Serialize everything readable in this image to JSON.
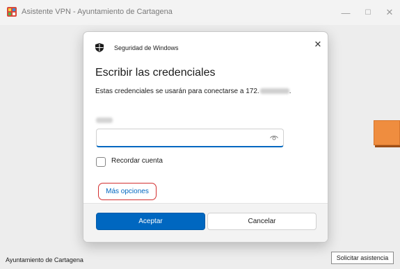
{
  "window": {
    "title": "Asistente VPN - Ayuntamiento de Cartagena",
    "footer_label": "Ayuntamiento de Cartagena",
    "assist_button": "Solicitar asistencia",
    "minimize_glyph": "—",
    "maximize_glyph": "☐",
    "close_glyph": "✕"
  },
  "dialog": {
    "security_title": "Seguridad de Windows",
    "close_glyph": "✕",
    "heading": "Escribir las credenciales",
    "description_prefix": "Estas credenciales se usarán para conectarse a 172.",
    "description_suffix": ".",
    "remember_label": "Recordar cuenta",
    "more_options": "Más opciones",
    "accept_label": "Aceptar",
    "cancel_label": "Cancelar"
  },
  "colors": {
    "accent": "#0067c0",
    "highlight_ring": "#d32f2f",
    "orange_button": "#ef8d3f"
  },
  "icons": {
    "app": "vpn-app-icon",
    "shield": "shield-icon",
    "eye": "eye-icon"
  }
}
